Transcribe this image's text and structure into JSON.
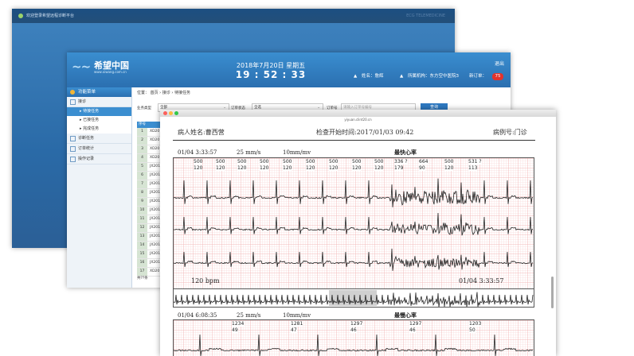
{
  "back_window": {
    "title": "欢迎登录希望远程诊断平台",
    "right": "ECG TELEMEDICINE"
  },
  "app": {
    "logo_cn": "希望中国",
    "logo_en": "www.xiwang.com.cn",
    "date": "2018年7月20日 星期五",
    "time": "19 : 52 : 33",
    "exit": "退出",
    "user_name": "姓名：詹辉",
    "org": "所属机构：东方空中医院3",
    "new_orders_label": "新订单：",
    "new_orders": "75"
  },
  "sidebar": {
    "header": "功能菜单",
    "items": [
      {
        "label": "接诊"
      },
      {
        "label": "▸ 待接任务",
        "selected": true
      },
      {
        "label": "▸ 已接任务"
      },
      {
        "label": "▸ 完成任务"
      },
      {
        "label": "诊断任务"
      },
      {
        "label": "订单统计"
      },
      {
        "label": "操作记录"
      }
    ]
  },
  "breadcrumb": "位置： 首页 › 接诊 › 待接任务",
  "filters": {
    "type_label": "业务类型",
    "type_value": "全部",
    "status_label": "订单状态",
    "status_value": "全选",
    "order_label": "订单号",
    "order_placeholder": "请输入订单号编号",
    "query_button": "查询"
  },
  "grid": {
    "header": "序号",
    "rows": [
      {
        "n": "1",
        "c": "XD20"
      },
      {
        "n": "2",
        "c": "XD20"
      },
      {
        "n": "3",
        "c": "XD20"
      },
      {
        "n": "4",
        "c": "XD20"
      },
      {
        "n": "5",
        "c": "JX201"
      },
      {
        "n": "6",
        "c": "JX201"
      },
      {
        "n": "7",
        "c": "JX201"
      },
      {
        "n": "8",
        "c": "JX201"
      },
      {
        "n": "9",
        "c": "JX201"
      },
      {
        "n": "10",
        "c": "JX201"
      },
      {
        "n": "11",
        "c": "JX201"
      },
      {
        "n": "12",
        "c": "JX201"
      },
      {
        "n": "13",
        "c": "JX201"
      },
      {
        "n": "14",
        "c": "JX201"
      },
      {
        "n": "15",
        "c": "JX201"
      },
      {
        "n": "16",
        "c": "JX201"
      },
      {
        "n": "17",
        "c": "XD20"
      }
    ],
    "total": "共??条"
  },
  "ecg_window": {
    "url": "yiyuan.clint20.cn",
    "patient": "病人姓名:曹西营",
    "exam_time": "检查开始时间:2017/01/03 09:42",
    "case_no": "病例号:门诊",
    "strip1": {
      "time": "01/04 3:33:57",
      "speed": "25 mm/s",
      "gain": "10mm/mv",
      "title": "最快心率",
      "rr_top": [
        "500",
        "500",
        "500",
        "500",
        "500",
        "500",
        "500",
        "500",
        "500",
        "336 ?",
        "664",
        "500",
        "531 ?"
      ],
      "hr_bottom": [
        "120",
        "120",
        "120",
        "120",
        "120",
        "120",
        "120",
        "120",
        "120",
        "179",
        "90",
        "120",
        "113"
      ],
      "bpm": "120 bpm",
      "time_end": "01/04 3:33:57"
    },
    "strip2": {
      "time": "01/04 6:08:35",
      "speed": "25 mm/s",
      "gain": "10mm/mv",
      "title": "最慢心率",
      "rr_top": [
        "1234",
        "1281",
        "1297",
        "1297",
        "1203"
      ],
      "hr_bottom": [
        "49",
        "47",
        "46",
        "46",
        "50"
      ]
    }
  },
  "colors": {
    "header_blue": "#2b6fb0",
    "badge_red": "#e2332c",
    "grid_red": "#f3b9b9"
  }
}
